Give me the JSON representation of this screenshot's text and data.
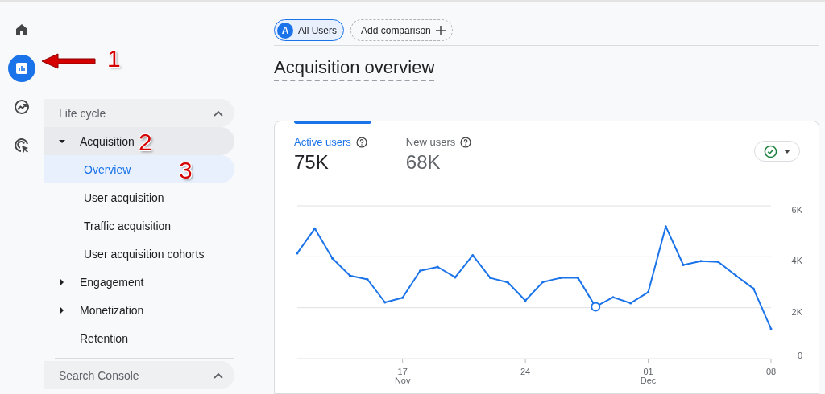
{
  "rail": [
    {
      "kind": "home",
      "selected": false
    },
    {
      "kind": "reports",
      "selected": true
    },
    {
      "kind": "explore",
      "selected": false
    },
    {
      "kind": "advertising",
      "selected": false
    }
  ],
  "sidebar": {
    "sections": [
      {
        "title": "Life cycle",
        "expanded": true,
        "items": [
          {
            "label": "Acquisition",
            "expanded": true,
            "selected": false,
            "hovered": true,
            "children": [
              {
                "label": "Overview",
                "selected": true
              },
              {
                "label": "User acquisition",
                "selected": false
              },
              {
                "label": "Traffic acquisition",
                "selected": false
              },
              {
                "label": "User acquisition cohorts",
                "selected": false
              }
            ]
          },
          {
            "label": "Engagement",
            "expanded": false,
            "selected": false,
            "hovered": false
          },
          {
            "label": "Monetization",
            "expanded": false,
            "selected": false,
            "hovered": false
          },
          {
            "label": "Retention",
            "selected": false,
            "hovered": false
          }
        ]
      },
      {
        "title": "Search Console",
        "expanded": true
      }
    ]
  },
  "comparisons": [
    {
      "kind": "segment",
      "badge": "A",
      "label": "All Users"
    },
    {
      "kind": "add",
      "label": "Add comparison"
    }
  ],
  "page_title": "Acquisition overview",
  "card": {
    "metrics": [
      {
        "label": "Active users",
        "value": "75K",
        "selected": true
      },
      {
        "label": "New users",
        "value": "68K",
        "selected": false
      }
    ],
    "chart_data": {
      "type": "line",
      "categories": [
        null,
        null,
        null,
        null,
        null,
        null,
        "17\nNov",
        null,
        null,
        null,
        null,
        null,
        null,
        "24",
        null,
        null,
        null,
        null,
        null,
        null,
        "01\nDec",
        null,
        null,
        null,
        null,
        null,
        null,
        "08"
      ],
      "series": [
        {
          "color": "#1a73e8",
          "values": [
            4140,
            5110,
            3940,
            3260,
            3110,
            2210,
            2390,
            3450,
            3600,
            3190,
            4060,
            3170,
            2990,
            2280,
            3010,
            3170,
            3170,
            2040,
            2410,
            2180,
            2610,
            5190,
            3680,
            3830,
            3800,
            3260,
            2750,
            1170
          ]
        }
      ],
      "ylim": [
        0,
        6000
      ],
      "yticks": [
        {
          "value": 0,
          "label": "0"
        },
        {
          "value": 2000,
          "label": "2K"
        },
        {
          "value": 4000,
          "label": "4K"
        },
        {
          "value": 6000,
          "label": "6K"
        }
      ]
    },
    "hovered_points": [
      false,
      false,
      false,
      false,
      false,
      false,
      false,
      false,
      false,
      false,
      false,
      false,
      false,
      false,
      false,
      false,
      false,
      true,
      false,
      false,
      false,
      false,
      false,
      false,
      false,
      false,
      false,
      false
    ]
  },
  "callouts": [
    {
      "kind": "arrow",
      "label": "1"
    },
    {
      "kind": "plain",
      "label": "2"
    },
    {
      "kind": "plain",
      "label": "3"
    }
  ]
}
